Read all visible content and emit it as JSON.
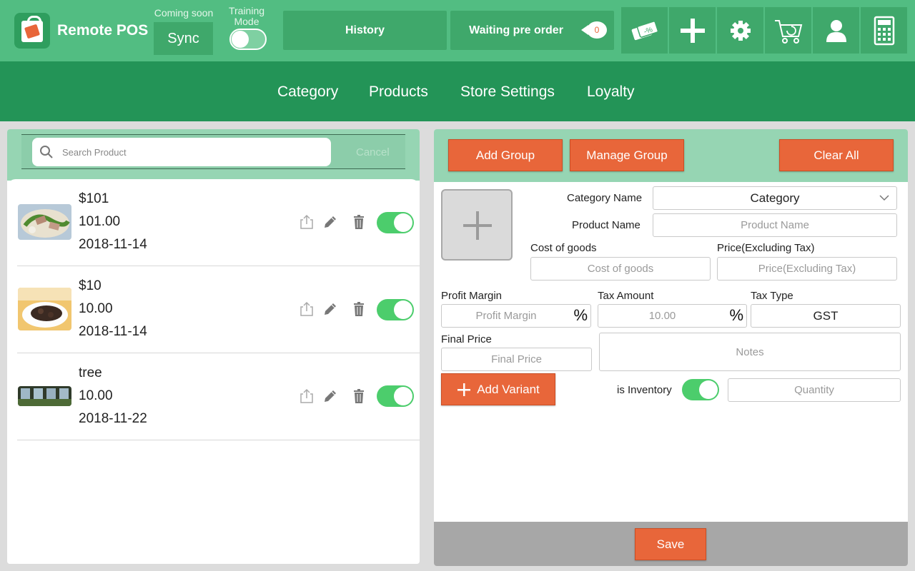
{
  "header": {
    "app_title": "Remote POS",
    "coming_soon": "Coming soon",
    "sync_label": "Sync",
    "training_label": "Training Mode",
    "training_mode_on": false,
    "history_label": "History",
    "waiting_label": "Waiting pre order",
    "waiting_count": "0",
    "icons": [
      "discount-icon",
      "plus-icon",
      "gear-icon",
      "cart-icon",
      "user-icon",
      "calculator-icon"
    ]
  },
  "nav": {
    "items": [
      "Category",
      "Products",
      "Store Settings",
      "Loyalty"
    ]
  },
  "product_list": {
    "search_placeholder": "Search Product",
    "cancel_label": "Cancel",
    "items": [
      {
        "name": "$101",
        "price": "101.00",
        "date": "2018-11-14",
        "enabled": true
      },
      {
        "name": "$10",
        "price": "10.00",
        "date": "2018-11-14",
        "enabled": true
      },
      {
        "name": "tree",
        "price": "10.00",
        "date": "2018-11-22",
        "enabled": true
      }
    ]
  },
  "form": {
    "add_group": "Add Group",
    "manage_group": "Manage Group",
    "clear_all": "Clear All",
    "category_name_label": "Category Name",
    "category_value": "Category",
    "product_name_label": "Product Name",
    "product_name_placeholder": "Product Name",
    "cost_label": "Cost of goods",
    "cost_placeholder": "Cost of goods",
    "price_label": "Price(Excluding Tax)",
    "price_placeholder": "Price(Excluding Tax)",
    "profit_label": "Profit Margin",
    "profit_placeholder": "Profit Margin",
    "tax_amount_label": "Tax Amount",
    "tax_amount_placeholder": "10.00",
    "tax_type_label": "Tax Type",
    "tax_type_value": "GST",
    "percent_symbol": "%",
    "final_price_label": "Final Price",
    "final_price_placeholder": "Final Price",
    "notes_placeholder": "Notes",
    "add_variant": "Add Variant",
    "is_inventory_label": "is Inventory",
    "is_inventory_on": true,
    "quantity_placeholder": "Quantity",
    "save_label": "Save"
  },
  "colors": {
    "topbar": "#52bd82",
    "navbar": "#239457",
    "accent_orange": "#e8663a",
    "toggle_green": "#4ccd6c"
  }
}
